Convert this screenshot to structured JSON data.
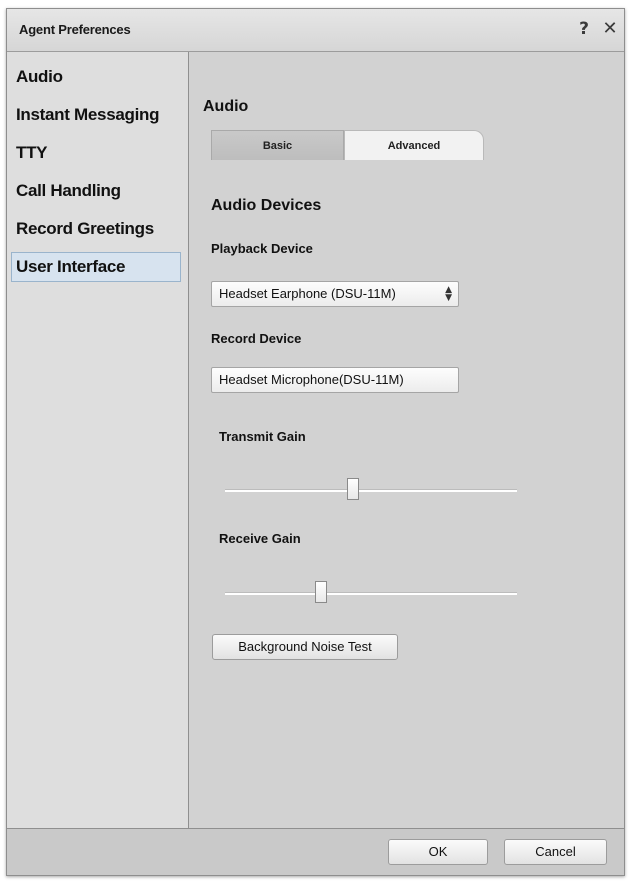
{
  "window": {
    "title": "Agent Preferences",
    "help_glyph": "?",
    "close_glyph": "✕"
  },
  "sidebar": {
    "items": [
      {
        "label": "Audio"
      },
      {
        "label": "Instant Messaging"
      },
      {
        "label": "TTY"
      },
      {
        "label": "Call Handling"
      },
      {
        "label": "Record Greetings"
      },
      {
        "label": "User Interface",
        "selected": true
      }
    ]
  },
  "main": {
    "section_title": "Audio",
    "tabs": [
      {
        "label": "Basic"
      },
      {
        "label": "Advanced",
        "selected": true
      }
    ],
    "devices_heading": "Audio Devices",
    "playback": {
      "label": "Playback Device",
      "value": "Headset Earphone (DSU-11M)",
      "arrow_icon": "updown-arrows-icon"
    },
    "record": {
      "label": "Record Device",
      "value": "Headset Microphone(DSU-11M)"
    },
    "transmit_gain": {
      "label": "Transmit Gain",
      "level": 0.44
    },
    "receive_gain": {
      "label": "Receive Gain",
      "level": 0.33
    },
    "noise_test_label": "Background Noise Test"
  },
  "footer": {
    "ok_label": "OK",
    "cancel_label": "Cancel"
  },
  "colors": {
    "selected_item_bg": "#d7e3ef",
    "selected_item_border": "#9ab4cc",
    "panel_bg": "#d2d2d2"
  }
}
